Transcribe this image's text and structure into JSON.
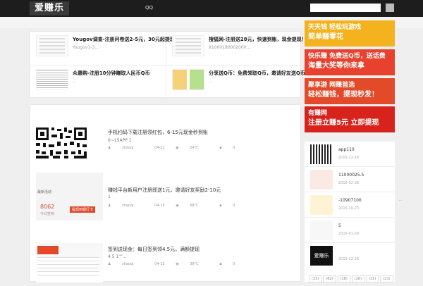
{
  "header": {
    "logo": "爱赚乐",
    "nav_item": "QQ",
    "search_placeholder": ""
  },
  "top_items": [
    {
      "title": "Yougov调查-注册问卷送2-5元，30元起提现！",
      "snippet": "Yougov1-3..."
    },
    {
      "title": "搜狐网-注册送28元，快速到账，现金提现！",
      "snippet": "91000180002000..."
    },
    {
      "title": "众惠购-注册10分钟赚取人民币Q币",
      "snippet": "..."
    },
    {
      "title": "分享送Q币：免费领取Q币，邀请好友送Q币",
      "snippet": "..."
    }
  ],
  "posts": [
    {
      "title": "手机扫码下载注册领红包，6-15元现金秒到账",
      "desc": "6~15APP  1",
      "author": "zhaoqi",
      "date": "04-21",
      "views": "24°C",
      "comments": "0"
    },
    {
      "title": "赚钱平台新用户注册即送1元，邀请好友奖励2-10元",
      "desc": "1",
      "author": "zhaoqi",
      "date": "04-15",
      "views": "68°C",
      "comments": "0"
    },
    {
      "title": "签到送现金：每日签到领4.5元，满额提现",
      "desc": "4.5  1\"\"...",
      "author": "zhaoqi",
      "date": "04-12",
      "views": "39°C",
      "comments": "0"
    }
  ],
  "post2_card": {
    "tag": "最新活动",
    "stat": "8062",
    "stat_label": "今日签到",
    "btn": "提现到银行卡"
  },
  "ads": [
    {
      "l1": "天天钱  轻松玩游戏",
      "l2": "简单赚零花",
      "bg": "#f3b21e"
    },
    {
      "l1": "快乐赚  免费送Q币，送话费",
      "l2": "海量大奖等你来拿",
      "bg": "#e8412d"
    },
    {
      "l1": "聚享游  网赚首选",
      "l2": "轻松赚钱，提现秒发！",
      "bg": "#e24a2a"
    },
    {
      "l1": "有赚网",
      "l2": "注册立赚5元 立即提现",
      "bg": "#d8231d"
    }
  ],
  "side_list": [
    {
      "name": "app110",
      "date": "2015-12-18"
    },
    {
      "name": "11000025.5",
      "date": "2016-02-28"
    },
    {
      "name": "-10907100",
      "date": "2015-10-23"
    },
    {
      "name": "5",
      "date": "2016-01-29"
    },
    {
      "name": "",
      "date": "2015-12-26",
      "logo": "爱赚乐"
    }
  ],
  "ellipsis": "...",
  "tags": [
    "(33)",
    "(62)",
    "(18)",
    "(26)",
    "(31)",
    "(21)"
  ],
  "colors": {
    "topbar": "#1d1d1d",
    "page_bg": "#efefef",
    "accent": "#d8231d"
  }
}
